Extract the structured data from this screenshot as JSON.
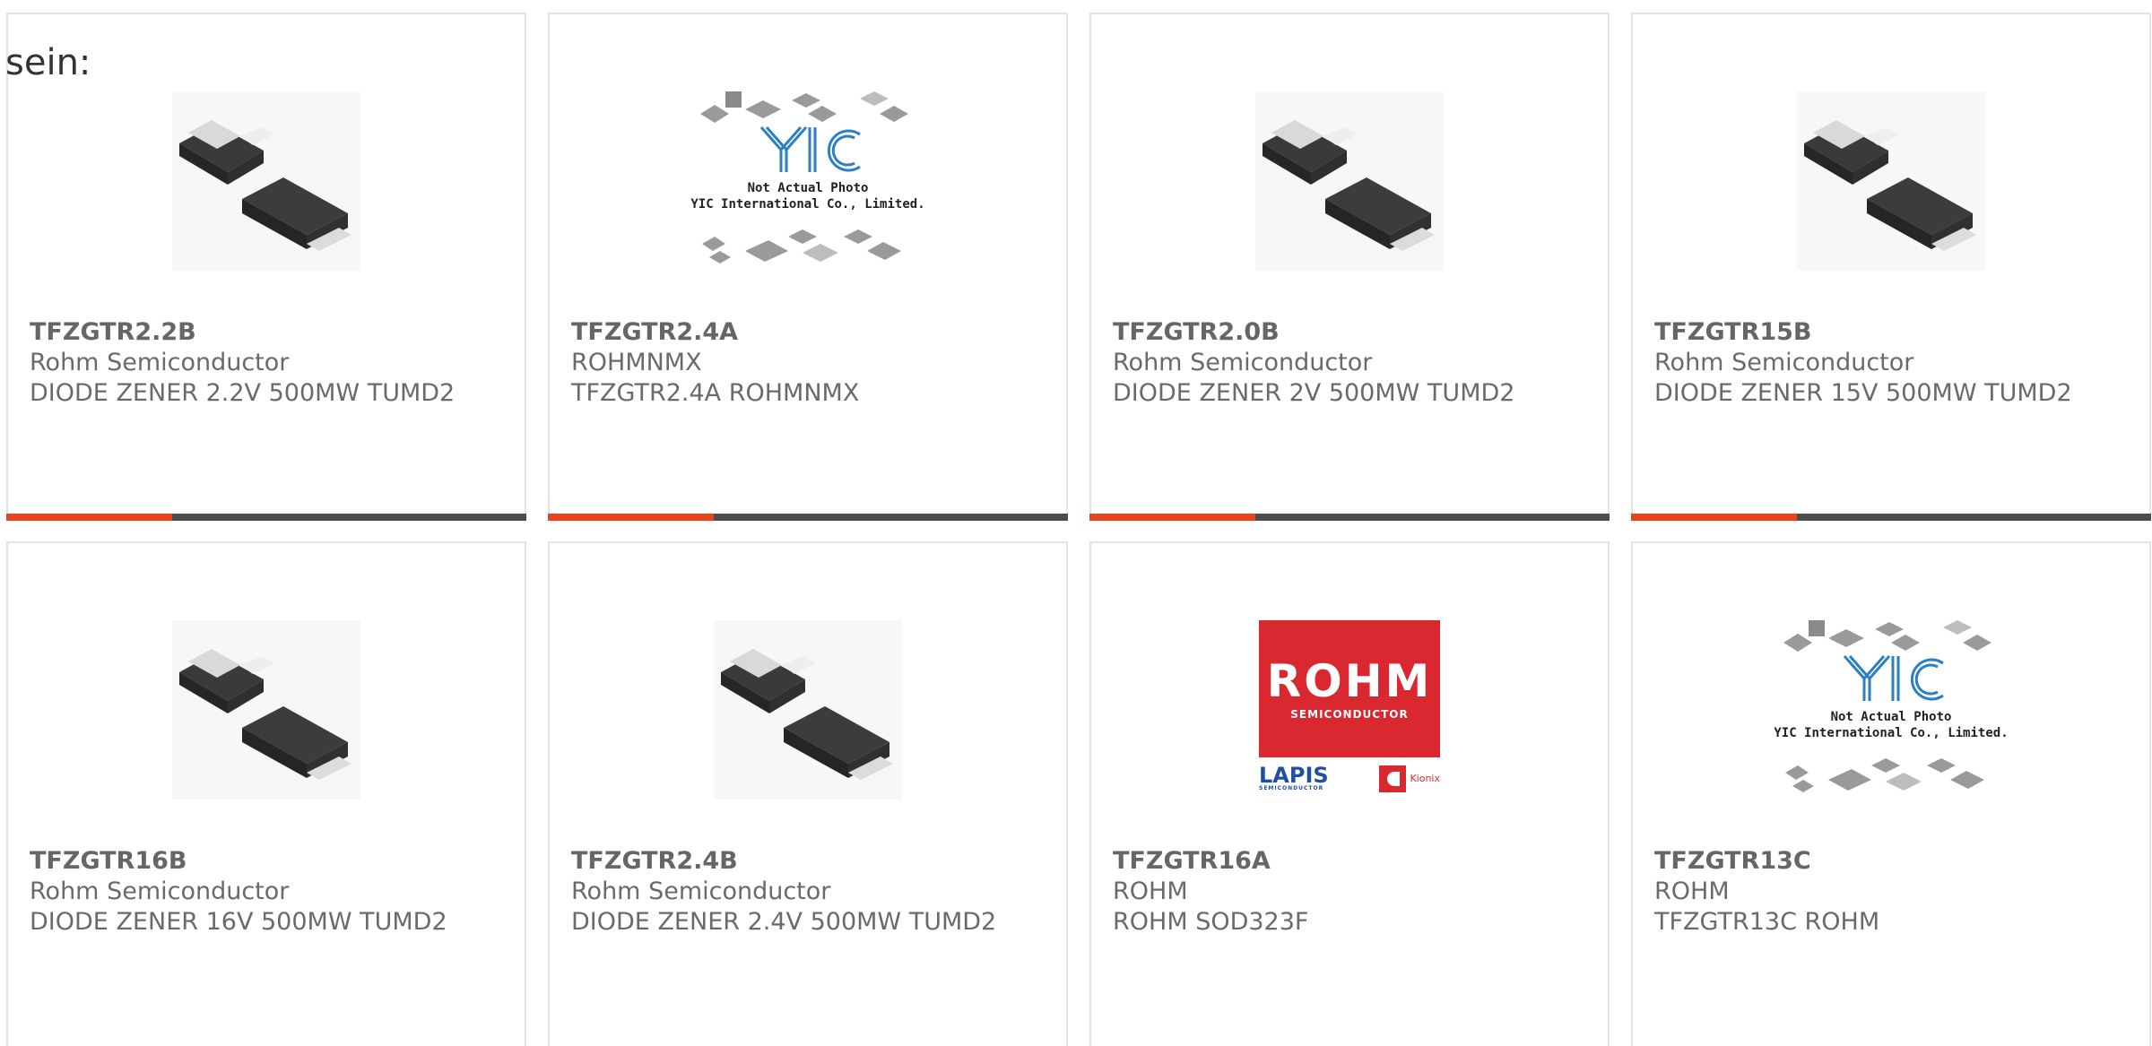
{
  "intro_text": "sein:",
  "yic_placeholder": {
    "line1": "Not Actual Photo",
    "line2": "YIC International Co., Limited."
  },
  "rohm_logo": {
    "word": "ROHM",
    "sub": "SEMICONDUCTOR",
    "lapis": "LAPIS",
    "lapis_sub": "SEMICONDUCTOR",
    "kionix": "Kionix"
  },
  "colors": {
    "accent_red": "#e8431c",
    "accent_dark": "#4d4d4d",
    "rohm_red": "#d9282f",
    "yic_blue": "#2b7fc4"
  },
  "products": [
    {
      "part": "TFZGTR2.2B",
      "manufacturer": "Rohm Semiconductor",
      "description": "DIODE ZENER 2.2V 500MW TUMD2",
      "image": "diode-package"
    },
    {
      "part": "TFZGTR2.4A",
      "manufacturer": "ROHMNMX",
      "description": "TFZGTR2.4A ROHMNMX",
      "image": "yic-placeholder"
    },
    {
      "part": "TFZGTR2.0B",
      "manufacturer": "Rohm Semiconductor",
      "description": "DIODE ZENER 2V 500MW TUMD2",
      "image": "diode-package"
    },
    {
      "part": "TFZGTR15B",
      "manufacturer": "Rohm Semiconductor",
      "description": "DIODE ZENER 15V 500MW TUMD2",
      "image": "diode-package"
    },
    {
      "part": "TFZGTR16B",
      "manufacturer": "Rohm Semiconductor",
      "description": "DIODE ZENER 16V 500MW TUMD2",
      "image": "diode-package"
    },
    {
      "part": "TFZGTR2.4B",
      "manufacturer": "Rohm Semiconductor",
      "description": "DIODE ZENER 2.4V 500MW TUMD2",
      "image": "diode-package"
    },
    {
      "part": "TFZGTR16A",
      "manufacturer": "ROHM",
      "description": "ROHM SOD323F",
      "image": "rohm-logo"
    },
    {
      "part": "TFZGTR13C",
      "manufacturer": "ROHM",
      "description": "TFZGTR13C ROHM",
      "image": "yic-placeholder"
    }
  ]
}
